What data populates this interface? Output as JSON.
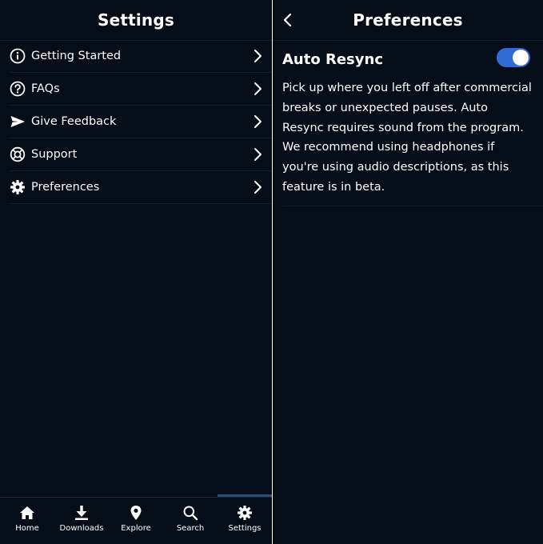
{
  "settings": {
    "title": "Settings",
    "items": [
      {
        "label": "Getting Started",
        "icon": "info-icon"
      },
      {
        "label": "FAQs",
        "icon": "question-icon"
      },
      {
        "label": "Give Feedback",
        "icon": "send-icon"
      },
      {
        "label": "Support",
        "icon": "lifebuoy-icon"
      },
      {
        "label": "Preferences",
        "icon": "gear-icon"
      }
    ]
  },
  "nav": {
    "active": "Settings",
    "items": [
      {
        "label": "Home",
        "icon": "home-icon"
      },
      {
        "label": "Downloads",
        "icon": "download-icon"
      },
      {
        "label": "Explore",
        "icon": "location-pin-icon"
      },
      {
        "label": "Search",
        "icon": "search-icon"
      },
      {
        "label": "Settings",
        "icon": "gear-icon"
      }
    ]
  },
  "preferences": {
    "title": "Preferences",
    "option_title": "Auto Resync",
    "toggle_on": true,
    "description": "Pick up where you left off after commercial breaks or unexpected pauses. Auto Resync requires sound from the program. We recommend using headphones if you're using audio descriptions, as this feature is in beta."
  },
  "colors": {
    "background": "#050d18",
    "divider": "#111e30",
    "toggle_on": "#2f6bd6",
    "active_tab_bar": "#2a4d79",
    "text": "#ffffff"
  }
}
